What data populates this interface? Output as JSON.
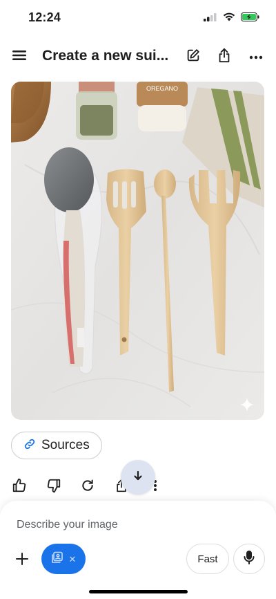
{
  "status_bar": {
    "time": "12:24",
    "icons": [
      "signal-icon",
      "wifi-icon",
      "battery-charging-icon"
    ],
    "battery_color": "#34c759"
  },
  "header": {
    "title": "Create a new sui...",
    "icons": [
      "menu-icon",
      "edit-icon",
      "share-icon",
      "more-icon"
    ]
  },
  "generated_image": {
    "subject": "wooden kitchen utensils on marble",
    "watermark_icon": "sparkle-icon"
  },
  "sources": {
    "label": "Sources",
    "icon": "link-icon",
    "accent": "#1a73e8"
  },
  "actions": {
    "icons": [
      "thumbs-up-icon",
      "thumbs-down-icon",
      "regenerate-icon",
      "share-icon",
      "more-vert-icon"
    ],
    "scroll_down_icon": "arrow-down-icon"
  },
  "composer": {
    "placeholder": "Describe your image",
    "add_icon": "plus-icon",
    "tool_chip_icon": "image-gen-icon",
    "tool_chip_color": "#1a73e8",
    "model_label": "Fast",
    "mic_icon": "mic-icon"
  }
}
